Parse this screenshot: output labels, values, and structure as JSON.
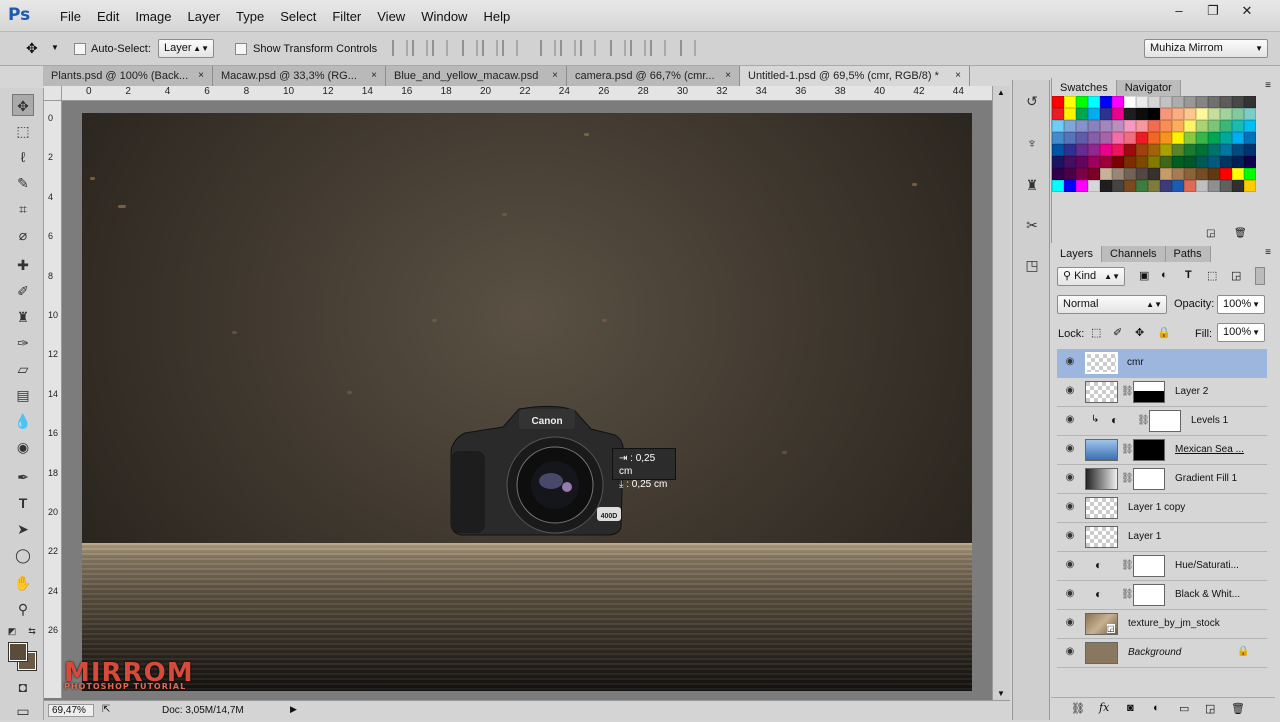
{
  "app": {
    "logo": "Ps"
  },
  "menu": [
    "File",
    "Edit",
    "Image",
    "Layer",
    "Type",
    "Select",
    "Filter",
    "View",
    "Window",
    "Help"
  ],
  "window_controls": [
    "–",
    "❐",
    "✕"
  ],
  "options": {
    "auto_select_label": "Auto-Select:",
    "auto_select_value": "Layer",
    "show_transform_label": "Show Transform Controls",
    "workspace": "Muhiza Mirrom"
  },
  "tabs": [
    {
      "label": "Plants.psd @ 100% (Back...",
      "close": "×"
    },
    {
      "label": "Macaw.psd @ 33,3% (RG...",
      "close": "×"
    },
    {
      "label": "Blue_and_yellow_macaw.psd",
      "close": "×"
    },
    {
      "label": "camera.psd @ 66,7% (cmr...",
      "close": "×"
    },
    {
      "label": "Untitled-1.psd @ 69,5% (cmr, RGB/8) *",
      "close": "×"
    }
  ],
  "ruler_h": [
    "0",
    "2",
    "4",
    "6",
    "8",
    "10",
    "12",
    "14",
    "16",
    "18",
    "20",
    "22",
    "24",
    "26",
    "28",
    "30",
    "32",
    "34",
    "36",
    "38",
    "40",
    "42",
    "44"
  ],
  "ruler_v": [
    "0",
    "2",
    "4",
    "6",
    "8",
    "10",
    "12",
    "14",
    "16",
    "18",
    "20",
    "22",
    "24",
    "26"
  ],
  "canvas": {
    "camera_brand": "Canon",
    "camera_model": "400D",
    "tooltip_x": "0,25 cm",
    "tooltip_y": "0,25 cm"
  },
  "watermark": {
    "title": "MIRROM",
    "subtitle": "PHOTOSHOP TUTORIAL"
  },
  "status": {
    "zoom": "69,47%",
    "doc": "Doc: 3,05M/14,7M"
  },
  "swatch_panel": {
    "tabs": [
      "Swatches",
      "Navigator"
    ]
  },
  "swatch_colors": [
    "#ff0000",
    "#ffff00",
    "#00ff00",
    "#00ffff",
    "#0000ff",
    "#ff00ff",
    "#ffffff",
    "#ebebeb",
    "#d6d6d6",
    "#c2c2c2",
    "#adadad",
    "#999999",
    "#858585",
    "#707070",
    "#5c5c5c",
    "#474747",
    "#333333",
    "#ed1c24",
    "#fff200",
    "#00a651",
    "#00aeef",
    "#2e3192",
    "#ec008c",
    "#1e1e1e",
    "#0d0d0d",
    "#000000",
    "#f7977a",
    "#f9ad81",
    "#fdc68a",
    "#fff79a",
    "#c4df9b",
    "#a3d39c",
    "#82ca9d",
    "#7bcdc8",
    "#6ecff6",
    "#7ea7d8",
    "#8493ca",
    "#8882be",
    "#a187be",
    "#bc8dbf",
    "#f49ac2",
    "#f6989d",
    "#f26c4f",
    "#f68e55",
    "#fbaf5c",
    "#fff467",
    "#acd372",
    "#7cc576",
    "#3bb878",
    "#1abbb4",
    "#00bff3",
    "#438ccb",
    "#5574b9",
    "#605ca8",
    "#855fa8",
    "#a763a8",
    "#f06ea9",
    "#f26d7d",
    "#ed1c24",
    "#f26522",
    "#f7941d",
    "#fff200",
    "#8dc73f",
    "#39b54a",
    "#00a651",
    "#00a99d",
    "#00aeef",
    "#0072bc",
    "#0054a6",
    "#2e3192",
    "#662d91",
    "#92278f",
    "#ec008c",
    "#ed145b",
    "#9e0b0f",
    "#a0410d",
    "#a3620a",
    "#aba000",
    "#598527",
    "#1a7b30",
    "#007236",
    "#00746b",
    "#0076a3",
    "#004b80",
    "#003471",
    "#1b1464",
    "#440e62",
    "#630460",
    "#9e005d",
    "#9e0039",
    "#790000",
    "#7b2e00",
    "#7d4900",
    "#827b00",
    "#406618",
    "#005e20",
    "#005826",
    "#005952",
    "#005b7f",
    "#003663",
    "#002157",
    "#0d004c",
    "#32004b",
    "#4b0049",
    "#7b0046",
    "#7a0026",
    "#c7b299",
    "#998675",
    "#736357",
    "#534741",
    "#37302d",
    "#c69c6d",
    "#a67c52",
    "#8c6239",
    "#754c24",
    "#603913",
    "#ff0000",
    "#ffff00",
    "#00ff00",
    "#00ffff",
    "#0000ff",
    "#ff00ff",
    "#d6d6d6",
    "#1e1e1e",
    "#444444",
    "#7c4a1e",
    "#3c7c3c",
    "#7c7c3c",
    "#3c3c7c",
    "#1c5cb0",
    "#e06a55",
    "#c0c0c0",
    "#909090",
    "#606060",
    "#303030",
    "#ffcc00"
  ],
  "layers_panel": {
    "tabs": [
      "Layers",
      "Channels",
      "Paths"
    ],
    "filter_kind": "Kind",
    "blend_mode": "Normal",
    "opacity_label": "Opacity:",
    "opacity_value": "100%",
    "lock_label": "Lock:",
    "fill_label": "Fill:",
    "fill_value": "100%",
    "layers": [
      {
        "name": "cmr",
        "selected": true
      },
      {
        "name": "Layer 2"
      },
      {
        "name": "Levels 1"
      },
      {
        "name": "Mexican Sea ..."
      },
      {
        "name": "Gradient Fill 1"
      },
      {
        "name": "Layer 1 copy"
      },
      {
        "name": "Layer 1"
      },
      {
        "name": "Hue/Saturati..."
      },
      {
        "name": "Black & Whit..."
      },
      {
        "name": "texture_by_jm_stock"
      },
      {
        "name": "Background"
      }
    ]
  }
}
